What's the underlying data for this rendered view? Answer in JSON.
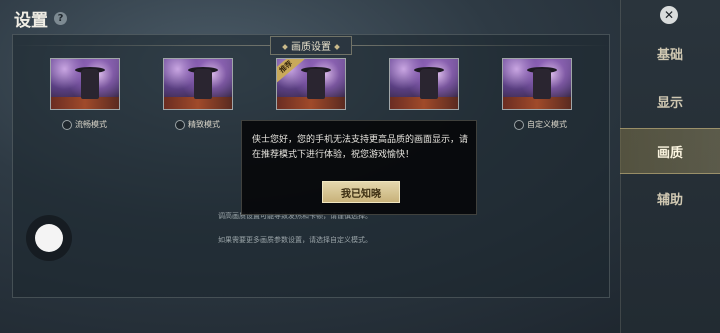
{
  "header": {
    "title": "设置",
    "help": "?"
  },
  "section": {
    "title": "画质设置"
  },
  "options": [
    {
      "label": "流畅模式"
    },
    {
      "label": "精致模式"
    },
    {
      "label": "",
      "badge": "推荐"
    },
    {
      "label": ""
    },
    {
      "label": "自定义模式"
    }
  ],
  "hints": [
    "调高画质设置可能导致发热和卡顿，请谨慎选择。",
    "如果需要更多画质参数设置，请选择自定义模式。"
  ],
  "sidebar": {
    "close": "✕",
    "tabs": [
      {
        "label": "基础",
        "active": false
      },
      {
        "label": "显示",
        "active": false
      },
      {
        "label": "画质",
        "active": true
      },
      {
        "label": "辅助",
        "active": false
      }
    ]
  },
  "dialog": {
    "message": "侠士您好，您的手机无法支持更高品质的画面显示，请在推荐模式下进行体验，祝您游戏愉快！",
    "confirm": "我已知晓"
  },
  "colors": {
    "accent_gold": "#c8b27a",
    "active_tab": "#bfa96e"
  }
}
